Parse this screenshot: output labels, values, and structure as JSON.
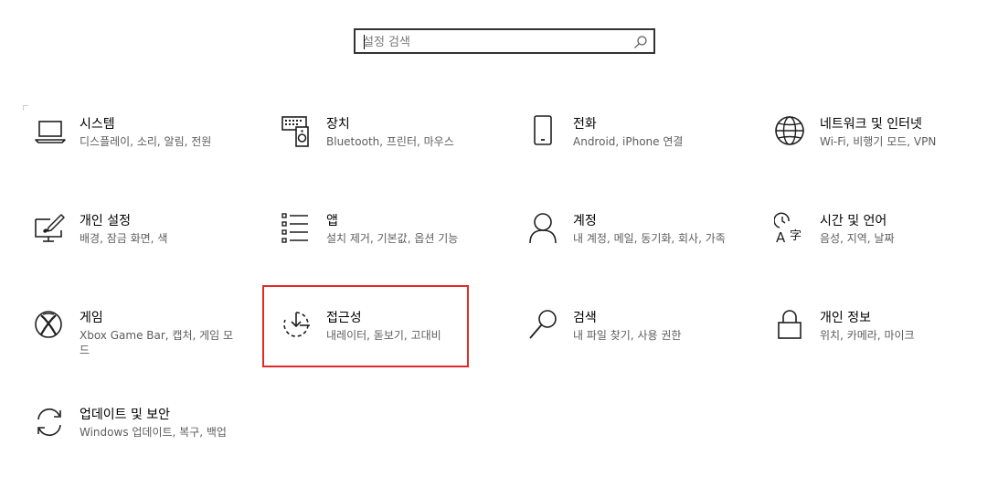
{
  "search": {
    "placeholder": "설정 검색",
    "value": ""
  },
  "tiles": [
    {
      "name": "tile-system",
      "icon": "laptop-icon",
      "title": "시스템",
      "desc": "디스플레이, 소리, 알림, 전원"
    },
    {
      "name": "tile-devices",
      "icon": "devices-icon",
      "title": "장치",
      "desc": "Bluetooth, 프린터, 마우스"
    },
    {
      "name": "tile-phone",
      "icon": "phone-icon",
      "title": "전화",
      "desc": "Android, iPhone 연결"
    },
    {
      "name": "tile-network",
      "icon": "globe-icon",
      "title": "네트워크 및 인터넷",
      "desc": "Wi-Fi, 비행기 모드, VPN"
    },
    {
      "name": "tile-personalization",
      "icon": "personalization-icon",
      "title": "개인 설정",
      "desc": "배경, 잠금 화면, 색"
    },
    {
      "name": "tile-apps",
      "icon": "apps-list-icon",
      "title": "앱",
      "desc": "설치 제거, 기본값, 옵션 기능"
    },
    {
      "name": "tile-accounts",
      "icon": "person-icon",
      "title": "계정",
      "desc": "내 계정, 메일, 동기화, 회사, 가족"
    },
    {
      "name": "tile-time-language",
      "icon": "time-language-icon",
      "title": "시간 및 언어",
      "desc": "음성, 지역, 날짜"
    },
    {
      "name": "tile-gaming",
      "icon": "xbox-icon",
      "title": "게임",
      "desc": "Xbox Game Bar, 캡처, 게임 모드"
    },
    {
      "name": "tile-ease-of-access",
      "icon": "ease-of-access-icon",
      "title": "접근성",
      "desc": "내레이터, 돋보기, 고대비"
    },
    {
      "name": "tile-search",
      "icon": "search-icon",
      "title": "검색",
      "desc": "내 파일 찾기, 사용 권한"
    },
    {
      "name": "tile-privacy",
      "icon": "lock-icon",
      "title": "개인 정보",
      "desc": "위치, 카메라, 마이크"
    },
    {
      "name": "tile-update-security",
      "icon": "sync-icon",
      "title": "업데이트 및 보안",
      "desc": "Windows 업데이트, 복구, 백업"
    }
  ],
  "highlighted_tile": "접근성",
  "colors": {
    "highlight_border": "#e02a2a",
    "description_text": "#5d5d5d",
    "icon_stroke": "#1f1f1f"
  }
}
